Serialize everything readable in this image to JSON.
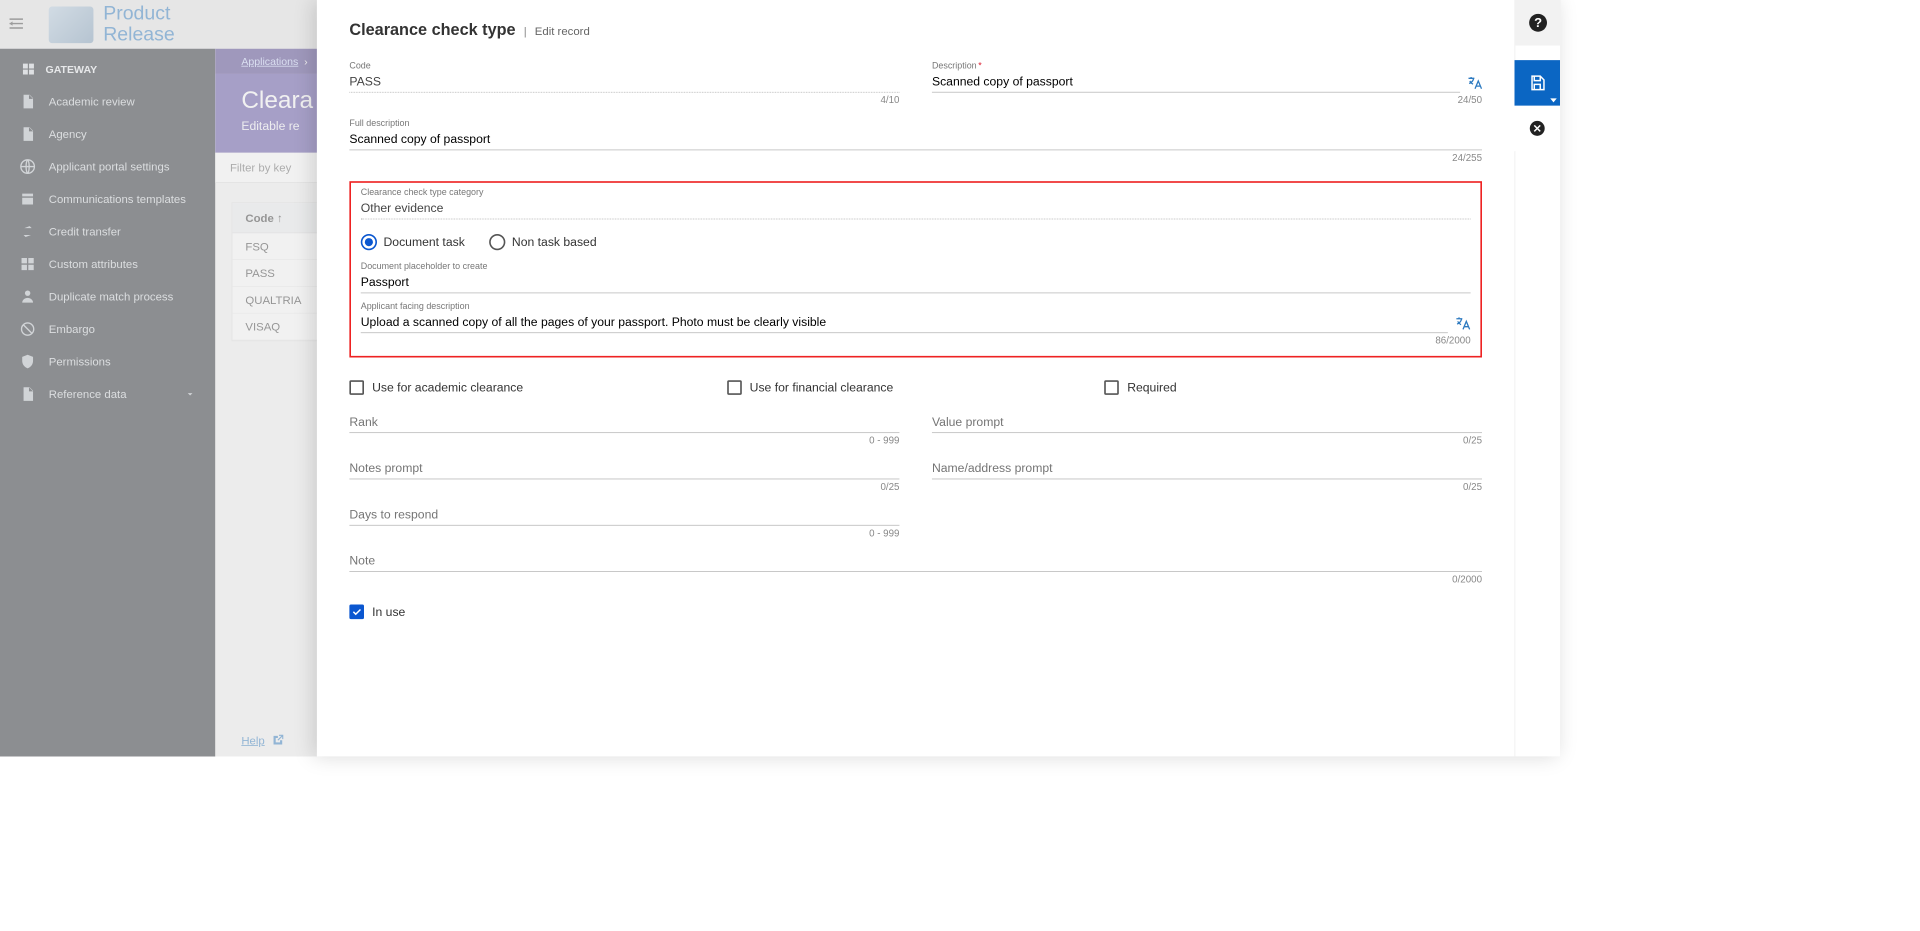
{
  "brand": {
    "line1": "Product",
    "line2": "Release"
  },
  "sidebar": {
    "section": "GATEWAY",
    "items": [
      {
        "label": "Academic review",
        "icon": "ic-doc"
      },
      {
        "label": "Agency",
        "icon": "ic-doc"
      },
      {
        "label": "Applicant portal settings",
        "icon": "ic-globe"
      },
      {
        "label": "Communications templates",
        "icon": "ic-tmpl"
      },
      {
        "label": "Credit transfer",
        "icon": "ic-swap"
      },
      {
        "label": "Custom attributes",
        "icon": "ic-grid"
      },
      {
        "label": "Duplicate match process",
        "icon": "ic-person"
      },
      {
        "label": "Embargo",
        "icon": "ic-block"
      },
      {
        "label": "Permissions",
        "icon": "ic-shield"
      },
      {
        "label": "Reference data",
        "icon": "ic-doc",
        "expandable": true
      }
    ]
  },
  "bg": {
    "breadcrumb": "Applications",
    "title": "Cleara",
    "subtitle": "Editable re",
    "filter_placeholder": "Filter by key",
    "table_header": "Code  ↑",
    "rows": [
      "FSQ",
      "PASS",
      "QUALTRIA",
      "VISAQ"
    ],
    "help": "Help"
  },
  "panel": {
    "title": "Clearance check type",
    "mode": "Edit record",
    "fields": {
      "code": {
        "label": "Code",
        "value": "PASS",
        "counter": "4/10"
      },
      "description": {
        "label": "Description",
        "required": true,
        "value": "Scanned copy of passport",
        "counter": "24/50"
      },
      "full_description": {
        "label": "Full description",
        "value": "Scanned copy of passport",
        "counter": "24/255"
      },
      "category": {
        "label": "Clearance check type category",
        "value": "Other evidence"
      },
      "radio": {
        "opt1": "Document task",
        "opt2": "Non task based",
        "selected": "opt1"
      },
      "placeholder": {
        "label": "Document placeholder to create",
        "value": "Passport"
      },
      "applicant_desc": {
        "label": "Applicant facing description",
        "value": "Upload a scanned copy of all the pages of your passport. Photo must be clearly visible",
        "counter": "86/2000"
      },
      "cb_academic": "Use for academic clearance",
      "cb_financial": "Use for financial clearance",
      "cb_required": "Required",
      "rank": {
        "label": "Rank",
        "helper": "0 - 999"
      },
      "value_prompt": {
        "label": "Value prompt",
        "helper": "0/25"
      },
      "notes_prompt": {
        "label": "Notes prompt",
        "helper": "0/25"
      },
      "name_addr": {
        "label": "Name/address prompt",
        "helper": "0/25"
      },
      "days": {
        "label": "Days to respond",
        "helper": "0 - 999"
      },
      "note": {
        "label": "Note",
        "helper": "0/2000"
      },
      "in_use": "In use"
    }
  }
}
